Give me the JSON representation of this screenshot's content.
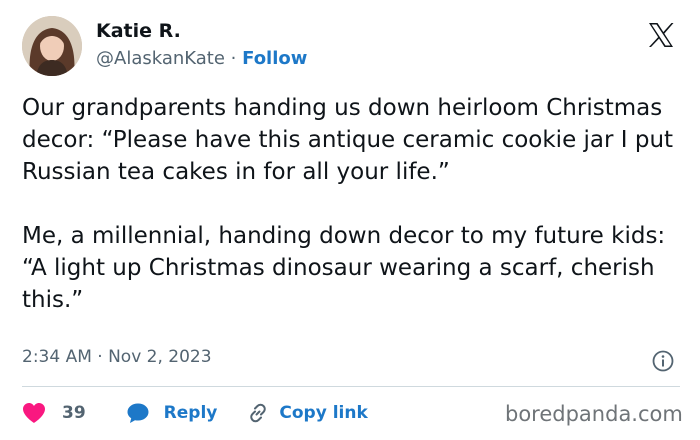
{
  "author": {
    "name": "Katie R.",
    "handle": "@AlaskanKate",
    "separator": "·",
    "follow_label": "Follow"
  },
  "tweet": {
    "paragraphs": [
      "Our grandparents handing us down heirloom Christmas decor: “Please have this antique ceramic cookie jar I put Russian tea cakes in for all your life.”",
      "Me, a millennial, handing down decor to my future kids: “A light up Christmas dinosaur wearing a scarf, cherish this.”"
    ],
    "timestamp": "2:34 AM · Nov 2, 2023"
  },
  "actions": {
    "like_count": "39",
    "reply_label": "Reply",
    "copy_link_label": "Copy link"
  },
  "watermark": "boredpanda.com",
  "icons": {
    "brand": "x-logo-icon",
    "info": "info-icon",
    "like": "heart-icon",
    "reply": "speech-bubble-icon",
    "copy": "link-icon"
  },
  "colors": {
    "text": "#0f1419",
    "secondary": "#536471",
    "accent": "#1d78c8",
    "like": "#f91880",
    "divider": "#cfd9de"
  }
}
